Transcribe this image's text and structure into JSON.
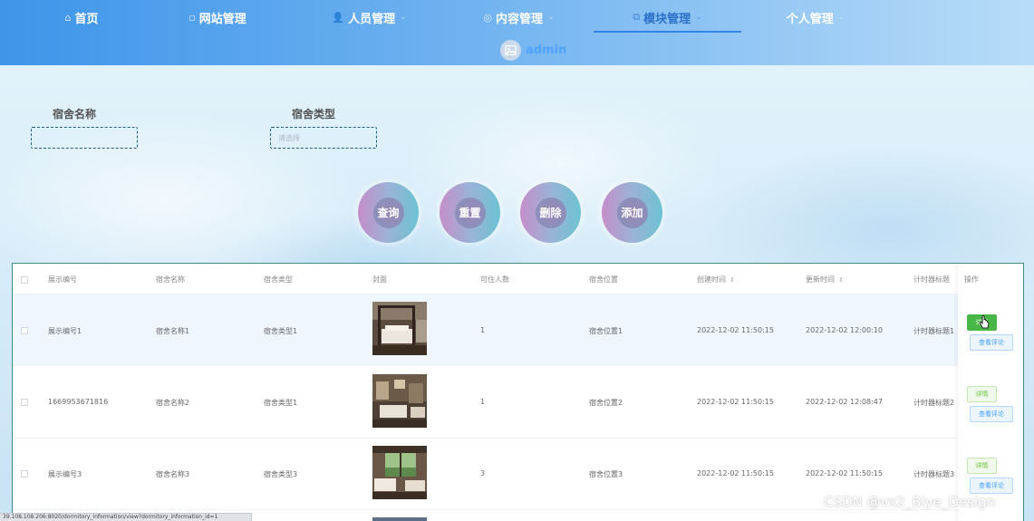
{
  "nav": {
    "items": [
      {
        "label": "首页",
        "icon": "home-icon",
        "has_caret": false
      },
      {
        "label": "网站管理",
        "icon": "grid-icon",
        "has_caret": false
      },
      {
        "label": "人员管理",
        "icon": "user-icon",
        "has_caret": true
      },
      {
        "label": "内容管理",
        "icon": "content-icon",
        "has_caret": true
      },
      {
        "label": "模块管理",
        "icon": "module-icon",
        "has_caret": true,
        "active": true
      },
      {
        "label": "个人管理",
        "icon": "person-icon",
        "has_caret": true
      }
    ],
    "user": {
      "name": "admin"
    }
  },
  "search": {
    "name_label": "宿舍名称",
    "name_value": "",
    "type_label": "宿舍类型",
    "type_placeholder": "请选择"
  },
  "actions": {
    "query": "查询",
    "reset": "重置",
    "delete": "删除",
    "add": "添加"
  },
  "table": {
    "headers": {
      "code": "展示编号",
      "name": "宿舍名称",
      "type": "宿舍类型",
      "cover": "封面",
      "capacity": "可住人数",
      "location": "宿舍位置",
      "created": "创建时间",
      "updated": "更新时间",
      "timer": "计时器标题",
      "ops": "操作"
    },
    "rows": [
      {
        "code": "展示编号1",
        "name": "宿舍名称1",
        "type": "宿舍类型1",
        "capacity": "1",
        "location": "宿舍位置1",
        "created": "2022-12-02 11:50:15",
        "updated": "2022-12-02 12:00:10",
        "timer": "计时器标题1"
      },
      {
        "code": "1669953671816",
        "name": "宿舍名称2",
        "type": "宿舍类型1",
        "capacity": "1",
        "location": "宿舍位置2",
        "created": "2022-12-02 11:50:15",
        "updated": "2022-12-02 12:08:47",
        "timer": "计时器标题2"
      },
      {
        "code": "展示编号3",
        "name": "宿舍名称3",
        "type": "宿舍类型3",
        "capacity": "3",
        "location": "宿舍位置3",
        "created": "2022-12-02 11:50:15",
        "updated": "2022-12-02 11:50:15",
        "timer": "计时器标题3"
      }
    ],
    "detail_label": "详情",
    "review_label": "查看评论"
  },
  "statusbar": {
    "url": "39.108.108.206:8020/dormitory_information/view?dormitory_information_id=1"
  },
  "watermark": "CSDN @vx2_Biye_Design",
  "colors": {
    "accent": "#409eff",
    "nav_active": "#2a6fc9",
    "detail_green": "#48b748"
  }
}
